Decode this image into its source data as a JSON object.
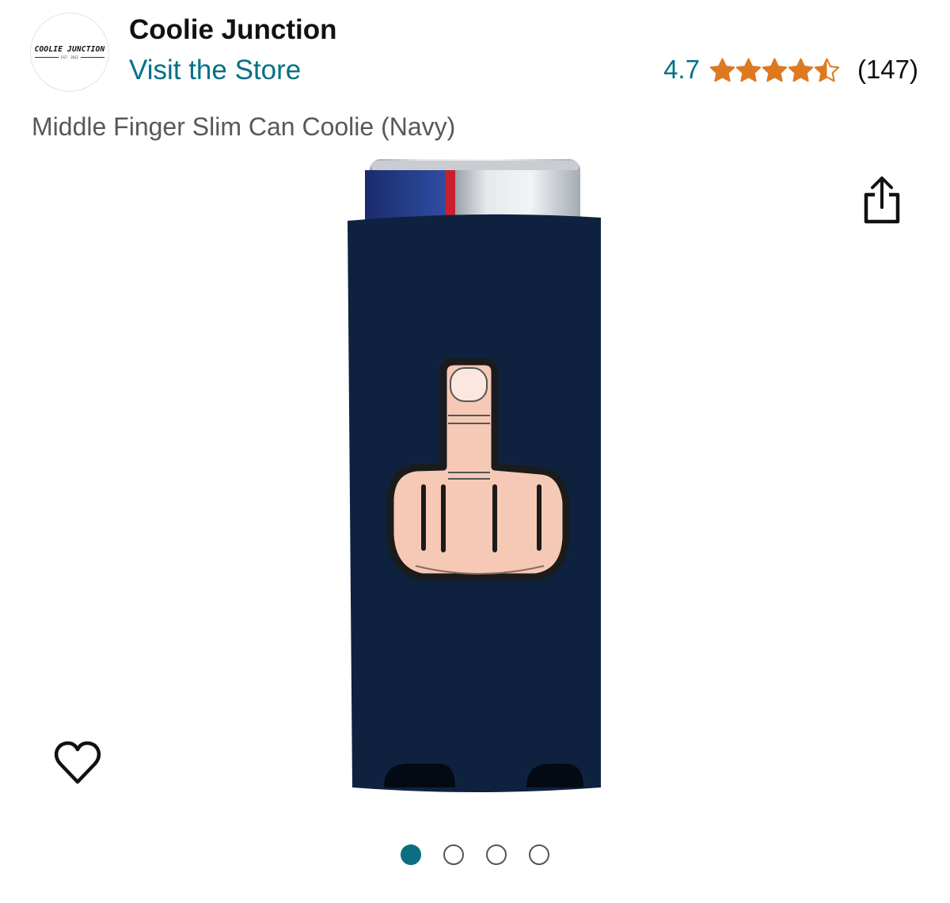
{
  "store": {
    "name": "Coolie Junction",
    "visit_label": "Visit the Store",
    "logo_text": "COOLIE JUNCTION",
    "logo_est": "EST. 2012"
  },
  "rating": {
    "score": "4.7",
    "stars_value": 4.7,
    "stars_max": 5,
    "count": "(147)"
  },
  "product": {
    "title": "Middle Finger Slim Can Coolie (Navy)"
  },
  "icons": {
    "share": "share-icon",
    "favorite": "heart-icon"
  },
  "carousel": {
    "total": 4,
    "active_index": 0
  },
  "colors": {
    "link": "#007185",
    "star": "#de7921",
    "coolie": "#0e2240",
    "dot_active": "#0c6e80"
  }
}
